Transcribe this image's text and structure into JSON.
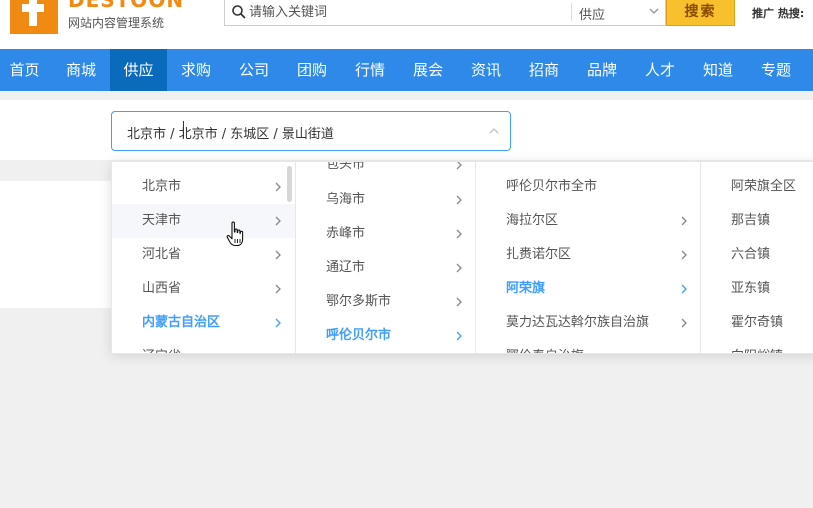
{
  "header": {
    "brand": "DESTOON",
    "subtitle": "网站内容管理系统",
    "search": {
      "placeholder": "请输入关键词",
      "category": "供应",
      "button": "搜索"
    },
    "hot_label": "推广 热搜:"
  },
  "nav": {
    "items": [
      {
        "label": "首页"
      },
      {
        "label": "商城"
      },
      {
        "label": "供应",
        "active": true
      },
      {
        "label": "求购"
      },
      {
        "label": "公司"
      },
      {
        "label": "团购"
      },
      {
        "label": "行情"
      },
      {
        "label": "展会"
      },
      {
        "label": "资讯"
      },
      {
        "label": "招商"
      },
      {
        "label": "品牌"
      },
      {
        "label": "人才"
      },
      {
        "label": "知道"
      },
      {
        "label": "专题"
      }
    ]
  },
  "cascader": {
    "value": "北京市 / 北京市 / 东城区 / 景山街道"
  },
  "dropdown": {
    "col1": [
      {
        "label": "北京市"
      },
      {
        "label": "天津市"
      },
      {
        "label": "河北省"
      },
      {
        "label": "山西省"
      },
      {
        "label": "内蒙古自治区"
      },
      {
        "label": "辽宁省"
      }
    ],
    "col2": [
      {
        "label": "包头市"
      },
      {
        "label": "乌海市"
      },
      {
        "label": "赤峰市"
      },
      {
        "label": "通辽市"
      },
      {
        "label": "鄂尔多斯市"
      },
      {
        "label": "呼伦贝尔市"
      }
    ],
    "col3": [
      {
        "label": "呼伦贝尔市全市"
      },
      {
        "label": "海拉尔区"
      },
      {
        "label": "扎赉诺尔区"
      },
      {
        "label": "阿荣旗"
      },
      {
        "label": "莫力达瓦达斡尔族自治旗"
      },
      {
        "label": "鄂伦春自治旗"
      }
    ],
    "col4": [
      {
        "label": "阿荣旗全区"
      },
      {
        "label": "那吉镇"
      },
      {
        "label": "六合镇"
      },
      {
        "label": "亚东镇"
      },
      {
        "label": "霍尔奇镇"
      },
      {
        "label": "向阳峪镇"
      }
    ]
  },
  "colors": {
    "nav_bg": "#2e89e8",
    "nav_active": "#0a6bbd",
    "accent": "#409eff",
    "logo": "#f08a12",
    "search_button": "#f9c02d"
  }
}
